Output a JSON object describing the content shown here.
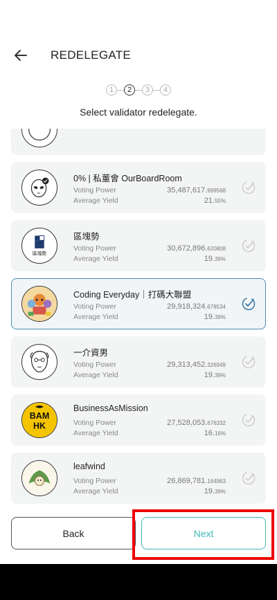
{
  "header": {
    "title": "REDELEGATE"
  },
  "stepper": {
    "steps": [
      "1",
      "2",
      "3",
      "4"
    ],
    "active_index": 1
  },
  "subtitle": "Select validator redelegate.",
  "labels": {
    "voting_power": "Voting Power",
    "average_yield": "Average Yield"
  },
  "validators": [
    {
      "name": "",
      "voting_power_int": "",
      "voting_power_dec": "",
      "yield_int": "",
      "yield_dec": ""
    },
    {
      "name": "0% | 私董會 OurBoardRoom",
      "voting_power_int": "35,487,617.",
      "voting_power_dec": "999568",
      "yield_int": "21.",
      "yield_dec": "55%"
    },
    {
      "name": "區塊勢",
      "voting_power_int": "30,672,896.",
      "voting_power_dec": "620808",
      "yield_int": "19.",
      "yield_dec": "39%"
    },
    {
      "name": "Coding Everyday｜打碼大聯盟",
      "voting_power_int": "29,918,324.",
      "voting_power_dec": "678534",
      "yield_int": "19.",
      "yield_dec": "39%",
      "selected": true
    },
    {
      "name": "一介資男",
      "voting_power_int": "29,313,452.",
      "voting_power_dec": "326949",
      "yield_int": "19.",
      "yield_dec": "39%"
    },
    {
      "name": "BusinessAsMission",
      "voting_power_int": "27,528,053.",
      "voting_power_dec": "676332",
      "yield_int": "16.",
      "yield_dec": "16%"
    },
    {
      "name": "leafwind",
      "voting_power_int": "26,869,781.",
      "voting_power_dec": "164963",
      "yield_int": "19.",
      "yield_dec": "39%"
    }
  ],
  "avatars": {
    "blockchain_logo_text": "區塊勢",
    "bam_line1": "BAM",
    "bam_line2": "HK"
  },
  "footer": {
    "back_label": "Back",
    "next_label": "Next"
  },
  "colors": {
    "accent": "#3fb7b7",
    "selected_border": "#4a8db8",
    "highlight": "#ee0000"
  }
}
